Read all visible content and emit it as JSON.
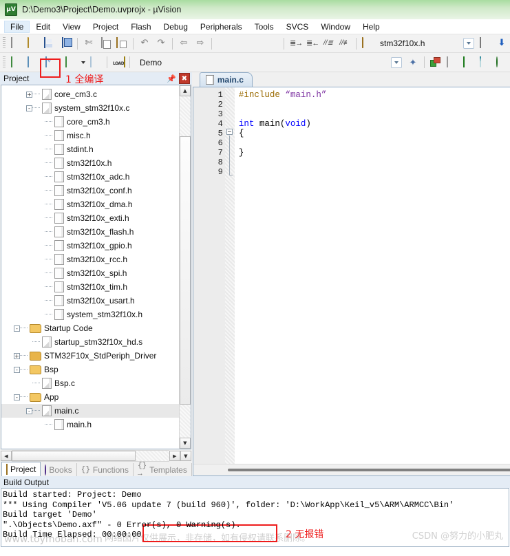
{
  "window": {
    "title": "D:\\Demo3\\Project\\Demo.uvprojx - µVision",
    "app_icon": "uvision-icon"
  },
  "menu": {
    "items": [
      {
        "label": "File",
        "active": true
      },
      {
        "label": "Edit",
        "active": false
      },
      {
        "label": "View",
        "active": false
      },
      {
        "label": "Project",
        "active": false
      },
      {
        "label": "Flash",
        "active": false
      },
      {
        "label": "Debug",
        "active": false
      },
      {
        "label": "Peripherals",
        "active": false
      },
      {
        "label": "Tools",
        "active": false
      },
      {
        "label": "SVCS",
        "active": false
      },
      {
        "label": "Window",
        "active": false
      },
      {
        "label": "Help",
        "active": false
      }
    ]
  },
  "toolbar_file": {
    "buttons": [
      {
        "name": "new-file",
        "icon": "new-file-icon"
      },
      {
        "name": "open-file",
        "icon": "open-folder-icon"
      },
      {
        "name": "save",
        "icon": "save-icon"
      },
      {
        "name": "save-all",
        "icon": "save-all-icon"
      },
      {
        "name": "cut",
        "icon": "cut-icon"
      },
      {
        "name": "copy",
        "icon": "copy-icon"
      },
      {
        "name": "paste",
        "icon": "paste-icon"
      },
      {
        "name": "undo",
        "icon": "undo-icon"
      },
      {
        "name": "redo",
        "icon": "redo-icon"
      },
      {
        "name": "navigate-back",
        "icon": "arrow-left-icon"
      },
      {
        "name": "navigate-forward",
        "icon": "arrow-right-icon"
      },
      {
        "name": "toggle-bookmark",
        "icon": "bookmark-icon"
      },
      {
        "name": "prev-bookmark",
        "icon": "bookmark-prev-icon"
      },
      {
        "name": "next-bookmark",
        "icon": "bookmark-next-icon"
      },
      {
        "name": "clear-bookmarks",
        "icon": "bookmark-clear-icon"
      },
      {
        "name": "indent-right",
        "icon": "indent-right-icon"
      },
      {
        "name": "indent-left",
        "icon": "indent-left-icon"
      },
      {
        "name": "comment-lines",
        "icon": "comment-icon"
      },
      {
        "name": "uncomment-lines",
        "icon": "uncomment-icon"
      },
      {
        "name": "find-in-files",
        "icon": "find-in-files-icon"
      }
    ],
    "find_value": "stm32f10x.h",
    "right_buttons": [
      {
        "name": "browse-symbols",
        "icon": "browse-document-icon"
      },
      {
        "name": "bookmark-jump",
        "icon": "down-arrow-icon"
      }
    ]
  },
  "toolbar_build": {
    "buttons": [
      {
        "name": "translate-file",
        "icon": "translate-icon"
      },
      {
        "name": "build-target",
        "icon": "build-icon"
      },
      {
        "name": "rebuild-all",
        "icon": "rebuild-all-icon"
      },
      {
        "name": "batch-build",
        "icon": "batch-build-icon"
      },
      {
        "name": "stop-build",
        "icon": "stop-build-icon"
      },
      {
        "name": "download",
        "icon": "load-icon"
      }
    ],
    "target_value": "Demo",
    "right_buttons": [
      {
        "name": "target-options",
        "icon": "magic-wand-icon"
      },
      {
        "name": "manage-project-items",
        "icon": "project-items-icon"
      },
      {
        "name": "manage-multi-project",
        "icon": "multi-project-icon"
      },
      {
        "name": "pack-installer",
        "icon": "green-diamond-icon"
      },
      {
        "name": "manage-run-time",
        "icon": "funnel-icon"
      },
      {
        "name": "select-software-packs",
        "icon": "globe-icon"
      }
    ]
  },
  "annotations": [
    {
      "id": "anno-1",
      "text": "1 全编译",
      "color": "#ee1c1c"
    },
    {
      "id": "anno-2",
      "text": "2 无报错",
      "color": "#ee1c1c"
    }
  ],
  "project_pane": {
    "caption": "Project",
    "pin_icon": "pin-icon",
    "close_icon": "close-icon",
    "tree": [
      {
        "label": "core_cm3.c",
        "indent": 2,
        "toggle": "+",
        "icon": "source-file-icon",
        "selected": false
      },
      {
        "label": "system_stm32f10x.c",
        "indent": 2,
        "toggle": "-",
        "icon": "source-file-icon",
        "selected": false
      },
      {
        "label": "core_cm3.h",
        "indent": 3,
        "toggle": "",
        "icon": "header-file-icon",
        "selected": false
      },
      {
        "label": "misc.h",
        "indent": 3,
        "toggle": "",
        "icon": "header-file-icon",
        "selected": false
      },
      {
        "label": "stdint.h",
        "indent": 3,
        "toggle": "",
        "icon": "header-file-icon",
        "selected": false
      },
      {
        "label": "stm32f10x.h",
        "indent": 3,
        "toggle": "",
        "icon": "header-file-icon",
        "selected": false
      },
      {
        "label": "stm32f10x_adc.h",
        "indent": 3,
        "toggle": "",
        "icon": "header-file-icon",
        "selected": false
      },
      {
        "label": "stm32f10x_conf.h",
        "indent": 3,
        "toggle": "",
        "icon": "header-file-icon",
        "selected": false
      },
      {
        "label": "stm32f10x_dma.h",
        "indent": 3,
        "toggle": "",
        "icon": "header-file-icon",
        "selected": false
      },
      {
        "label": "stm32f10x_exti.h",
        "indent": 3,
        "toggle": "",
        "icon": "header-file-icon",
        "selected": false
      },
      {
        "label": "stm32f10x_flash.h",
        "indent": 3,
        "toggle": "",
        "icon": "header-file-icon",
        "selected": false
      },
      {
        "label": "stm32f10x_gpio.h",
        "indent": 3,
        "toggle": "",
        "icon": "header-file-icon",
        "selected": false
      },
      {
        "label": "stm32f10x_rcc.h",
        "indent": 3,
        "toggle": "",
        "icon": "header-file-icon",
        "selected": false
      },
      {
        "label": "stm32f10x_spi.h",
        "indent": 3,
        "toggle": "",
        "icon": "header-file-icon",
        "selected": false
      },
      {
        "label": "stm32f10x_tim.h",
        "indent": 3,
        "toggle": "",
        "icon": "header-file-icon",
        "selected": false
      },
      {
        "label": "stm32f10x_usart.h",
        "indent": 3,
        "toggle": "",
        "icon": "header-file-icon",
        "selected": false
      },
      {
        "label": "system_stm32f10x.h",
        "indent": 3,
        "toggle": "",
        "icon": "header-file-icon",
        "selected": false
      },
      {
        "label": "Startup Code",
        "indent": 1,
        "toggle": "-",
        "icon": "folder-open-icon",
        "selected": false
      },
      {
        "label": "startup_stm32f10x_hd.s",
        "indent": 2,
        "toggle": "",
        "icon": "source-file-icon",
        "selected": false
      },
      {
        "label": "STM32F10x_StdPeriph_Driver",
        "indent": 1,
        "toggle": "+",
        "icon": "folder-closed-icon",
        "selected": false
      },
      {
        "label": "Bsp",
        "indent": 1,
        "toggle": "-",
        "icon": "folder-open-icon",
        "selected": false
      },
      {
        "label": "Bsp.c",
        "indent": 2,
        "toggle": "",
        "icon": "source-file-icon",
        "selected": false
      },
      {
        "label": "App",
        "indent": 1,
        "toggle": "-",
        "icon": "folder-open-icon",
        "selected": false
      },
      {
        "label": "main.c",
        "indent": 2,
        "toggle": "-",
        "icon": "source-file-icon",
        "selected": true
      },
      {
        "label": "main.h",
        "indent": 3,
        "toggle": "",
        "icon": "header-file-icon",
        "selected": false
      }
    ],
    "tabs": [
      {
        "label": "Project",
        "icon": "project-tab-icon",
        "active": true
      },
      {
        "label": "Books",
        "icon": "books-tab-icon",
        "active": false
      },
      {
        "label": "Functions",
        "icon": "functions-tab-icon",
        "active": false
      },
      {
        "label": "Templates",
        "icon": "templates-tab-icon",
        "active": false
      }
    ]
  },
  "editor": {
    "tab_label": "main.c",
    "tab_icon": "source-file-icon",
    "line_numbers": [
      "1",
      "2",
      "3",
      "4",
      "5",
      "6",
      "7",
      "8",
      "9"
    ],
    "lines": [
      {
        "n": 1,
        "tokens": [
          {
            "t": "#include ",
            "c": "pre"
          },
          {
            "t": "“main.h”",
            "c": "str"
          }
        ]
      },
      {
        "n": 2,
        "tokens": []
      },
      {
        "n": 3,
        "tokens": []
      },
      {
        "n": 4,
        "tokens": [
          {
            "t": "int ",
            "c": "kw"
          },
          {
            "t": "main(",
            "c": "id"
          },
          {
            "t": "void",
            "c": "kw"
          },
          {
            "t": ")",
            "c": "id"
          }
        ]
      },
      {
        "n": 5,
        "tokens": [
          {
            "t": "{",
            "c": "id"
          }
        ]
      },
      {
        "n": 6,
        "tokens": []
      },
      {
        "n": 7,
        "tokens": [
          {
            "t": "}",
            "c": "id"
          }
        ]
      },
      {
        "n": 8,
        "tokens": []
      },
      {
        "n": 9,
        "tokens": []
      }
    ]
  },
  "build_output": {
    "caption": "Build Output",
    "lines": [
      "Build started: Project: Demo",
      "*** Using Compiler 'V5.06 update 7 (build 960)', folder: 'D:\\WorkApp\\Keil_v5\\ARM\\ARMCC\\Bin'",
      "Build target 'Demo'",
      "\".\\Objects\\Demo.axf\" - 0 Error(s), 0 Warning(s).",
      "Build Time Elapsed:  00:00:00"
    ]
  },
  "watermark": {
    "url_text": "www.toymoban.com",
    "cn_text": "网络图片仅供展示，非存储，如有侵权请联系删除。",
    "csdn_text": "CSDN @努力的小肥丸"
  }
}
